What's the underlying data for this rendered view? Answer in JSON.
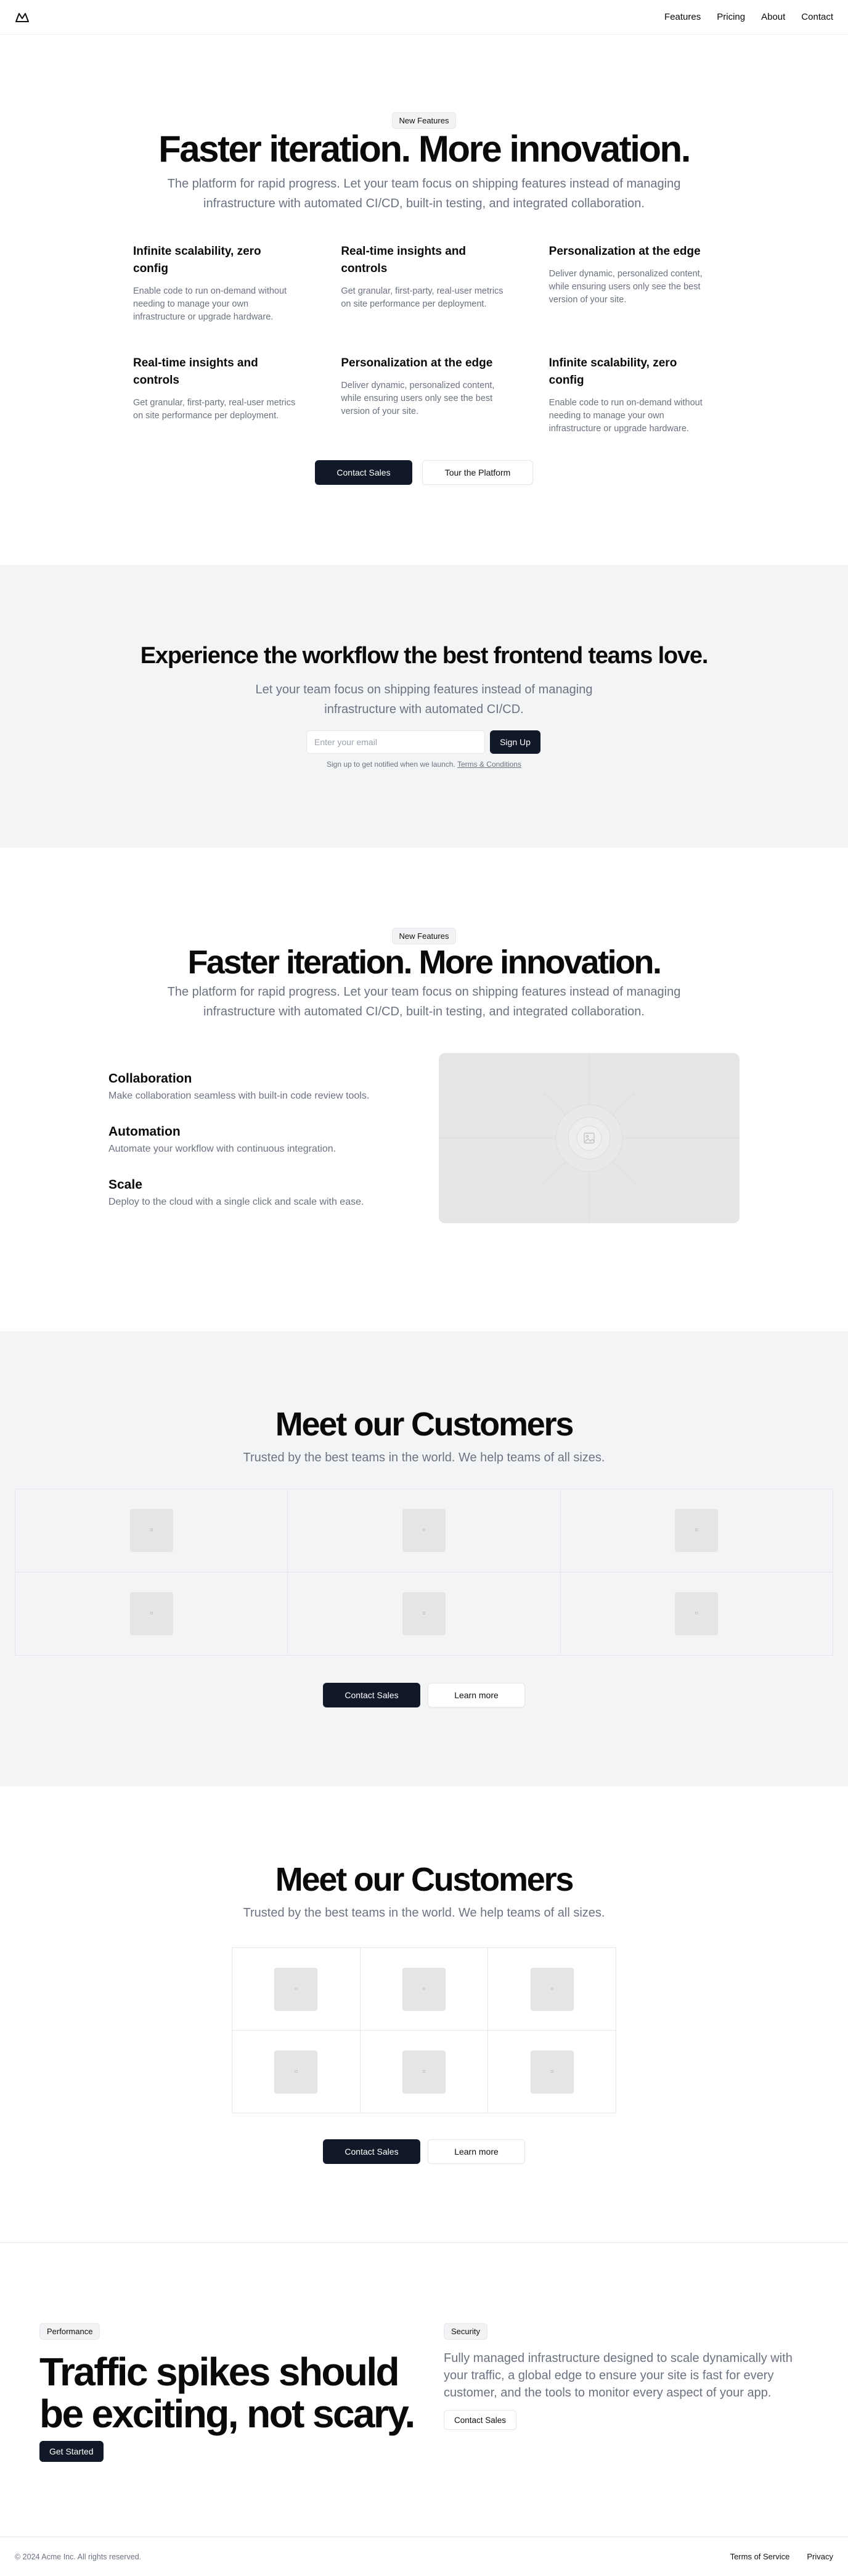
{
  "nav": {
    "links": [
      "Features",
      "Pricing",
      "About",
      "Contact"
    ]
  },
  "hero": {
    "badge": "New Features",
    "title": "Faster iteration. More innovation.",
    "description": "The platform for rapid progress. Let your team focus on shipping features instead of managing infrastructure with automated CI/CD, built-in testing, and integrated collaboration.",
    "features": [
      {
        "title": "Infinite scalability, zero config",
        "body": "Enable code to run on-demand without needing to manage your own infrastructure or upgrade hardware."
      },
      {
        "title": "Real-time insights and controls",
        "body": "Get granular, first-party, real-user metrics on site performance per deployment."
      },
      {
        "title": "Personalization at the edge",
        "body": "Deliver dynamic, personalized content, while ensuring users only see the best version of your site."
      },
      {
        "title": "Real-time insights and controls",
        "body": "Get granular, first-party, real-user metrics on site performance per deployment."
      },
      {
        "title": "Personalization at the edge",
        "body": "Deliver dynamic, personalized content, while ensuring users only see the best version of your site."
      },
      {
        "title": "Infinite scalability, zero config",
        "body": "Enable code to run on-demand without needing to manage your own infrastructure or upgrade hardware."
      }
    ],
    "primary_cta": "Contact Sales",
    "secondary_cta": "Tour the Platform"
  },
  "signup": {
    "title": "Experience the workflow the best frontend teams love.",
    "description": "Let your team focus on shipping features instead of managing infrastructure with automated CI/CD.",
    "email_placeholder": "Enter your email",
    "button": "Sign Up",
    "note": "Sign up to get notified when we launch.",
    "terms_link": "Terms & Conditions"
  },
  "features2": {
    "badge": "New Features",
    "title": "Faster iteration. More innovation.",
    "description": "The platform for rapid progress. Let your team focus on shipping features instead of managing infrastructure with automated CI/CD, built-in testing, and integrated collaboration.",
    "items": [
      {
        "title": "Collaboration",
        "body": "Make collaboration seamless with built-in code review tools."
      },
      {
        "title": "Automation",
        "body": "Automate your workflow with continuous integration."
      },
      {
        "title": "Scale",
        "body": "Deploy to the cloud with a single click and scale with ease."
      }
    ],
    "media_icon": "image-placeholder-icon"
  },
  "customers1": {
    "title": "Meet our Customers",
    "subtitle": "Trusted by the best teams in the world. We help teams of all sizes.",
    "primary_cta": "Contact Sales",
    "secondary_cta": "Learn more"
  },
  "customers2": {
    "title": "Meet our Customers",
    "subtitle": "Trusted by the best teams in the world. We help teams of all sizes.",
    "primary_cta": "Contact Sales",
    "secondary_cta": "Learn more"
  },
  "traffic": {
    "badge": "Performance",
    "title": "Traffic spikes should be exciting, not scary.",
    "cta": "Get Started",
    "right_badge": "Security",
    "description": "Fully managed infrastructure designed to scale dynamically with your traffic, a global edge to ensure your site is fast for every customer, and the tools to monitor every aspect of your app.",
    "right_cta": "Contact Sales"
  },
  "footer": {
    "copyright": "© 2024 Acme Inc. All rights reserved.",
    "links": [
      "Terms of Service",
      "Privacy"
    ]
  },
  "colors": {
    "primary_button": "#111827",
    "muted_text": "#6b7280",
    "section_bg": "#f3f4f6",
    "placeholder": "#e5e5e5"
  }
}
